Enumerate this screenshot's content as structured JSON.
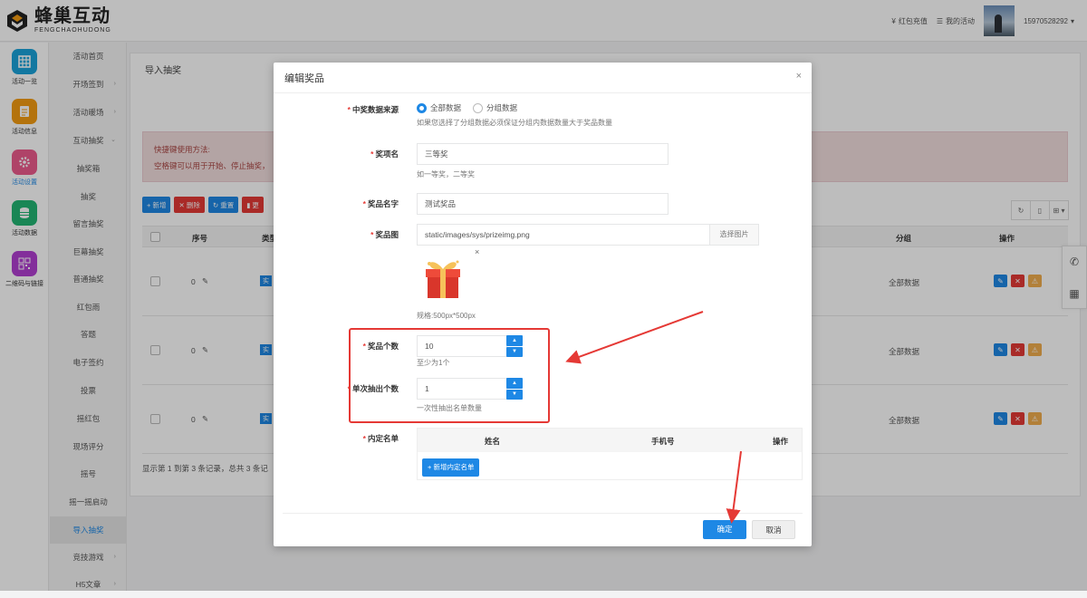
{
  "colors": {
    "accent": "#1e88e5",
    "danger": "#e53935",
    "warning": "#f0ad4e",
    "rail_blue": "#1aa3d9",
    "rail_orange": "#f39c12",
    "rail_pink": "#ec5b8d",
    "rail_green": "#22b573",
    "rail_purple": "#b13fd1"
  },
  "brand": {
    "name_cn": "蜂巢互动",
    "name_en": "FENGCHAOHUDONG"
  },
  "top_nav": {
    "recharge": "红包充值",
    "my_activity": "我的活动",
    "user": "15970528292",
    "recharge_icon": "yen-icon",
    "activity_icon": "list-icon"
  },
  "rail": [
    {
      "label": "活动一览",
      "icon": "grid-icon"
    },
    {
      "label": "活动信息",
      "icon": "document-icon"
    },
    {
      "label": "活动设置",
      "icon": "gear-icon"
    },
    {
      "label": "活动数据",
      "icon": "database-icon"
    },
    {
      "label": "二维码与链接",
      "icon": "qrcode-icon"
    }
  ],
  "submenu": [
    {
      "label": "活动首页",
      "arrow": ""
    },
    {
      "label": "开场签到",
      "arrow": "›"
    },
    {
      "label": "活动暖场",
      "arrow": "›"
    },
    {
      "label": "互动抽奖",
      "arrow": "⌄"
    },
    {
      "label": "抽奖箱",
      "arrow": ""
    },
    {
      "label": "抽奖",
      "arrow": ""
    },
    {
      "label": "留言抽奖",
      "arrow": ""
    },
    {
      "label": "巨幕抽奖",
      "arrow": ""
    },
    {
      "label": "普通抽奖",
      "arrow": ""
    },
    {
      "label": "红包雨",
      "arrow": ""
    },
    {
      "label": "答题",
      "arrow": ""
    },
    {
      "label": "电子签约",
      "arrow": ""
    },
    {
      "label": "投票",
      "arrow": ""
    },
    {
      "label": "摇红包",
      "arrow": ""
    },
    {
      "label": "现场评分",
      "arrow": ""
    },
    {
      "label": "摇号",
      "arrow": ""
    },
    {
      "label": "摇一摇启动",
      "arrow": ""
    },
    {
      "label": "导入抽奖",
      "arrow": ""
    },
    {
      "label": "竞技游戏",
      "arrow": "›"
    },
    {
      "label": "H5文章",
      "arrow": "›"
    }
  ],
  "page": {
    "title": "导入抽奖",
    "alert_title": "快捷键使用方法:",
    "alert_text": "空格键可以用于开始、停止抽奖，",
    "toolbar": {
      "add": "+ 新增",
      "delete": "✕ 删除",
      "reset": "↻ 重置",
      "fourth": "▮ 更"
    },
    "tools": [
      "↻",
      "▯",
      "⊞ ▾"
    ],
    "table": {
      "headers": {
        "seq": "序号",
        "type": "类型",
        "group": "分组",
        "ops": "操作"
      },
      "rows": [
        {
          "seq": "0",
          "type": "实",
          "group": "全部数据"
        },
        {
          "seq": "0",
          "type": "实",
          "group": "全部数据"
        },
        {
          "seq": "0",
          "type": "实",
          "group": "全部数据"
        }
      ]
    },
    "footer": "显示第 1 到第 3 条记录，总共 3 条记"
  },
  "modal": {
    "title": "编辑奖品",
    "close": "×",
    "source_label": "中奖数据来源",
    "source_options": [
      "全部数据",
      "分组数据"
    ],
    "source_help": "如果您选择了分组数据必须保证分组内数据数量大于奖品数量",
    "level_label": "奖项名",
    "level_value": "三等奖",
    "level_help": "如一等奖，二等奖",
    "prize_name_label": "奖品名字",
    "prize_name_value": "测试奖品",
    "image_label": "奖品图",
    "image_value": "static/images/sys/prizeimg.png",
    "image_pick": "选择图片",
    "image_remove": "×",
    "image_spec": "规格:500px*500px",
    "count_label": "奖品个数",
    "count_value": "10",
    "count_help": "至少为1个",
    "per_draw_label": "单次抽出个数",
    "per_draw_value": "1",
    "per_draw_help": "一次性抽出名单数量",
    "preset_label": "内定名单",
    "preset_headers": [
      "姓名",
      "手机号",
      "操作"
    ],
    "preset_add": "+ 新增内定名单",
    "ok": "确定",
    "cancel": "取消"
  }
}
